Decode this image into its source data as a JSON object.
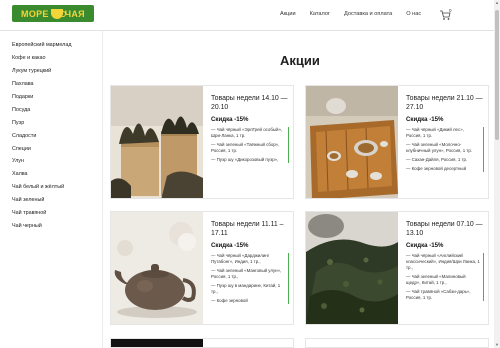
{
  "logo": {
    "left": "МОРЕ",
    "right": "ЧАЯ"
  },
  "nav": [
    "Акции",
    "Каталог",
    "Доставка и оплата",
    "О нас"
  ],
  "cart": {
    "count": "0"
  },
  "sidebar": {
    "items": [
      "Европейский мармелад",
      "Кофе и какао",
      "Лукум турецкий",
      "Пахлава",
      "Подарки",
      "Посуда",
      "Пуэр",
      "Сладости",
      "Специи",
      "Улун",
      "Халва",
      "Чай белый и жёлтый",
      "Чай зеленый",
      "Чай травяной",
      "Чай черный"
    ]
  },
  "page": {
    "title": "Акции"
  },
  "cards": [
    {
      "title": "Товары недели 14.10 — 20.10",
      "discount": "Скидка -15%",
      "items": [
        "— Чай чёрный «ЭрлГрей особый», Шри-Ланка, 1 тр.",
        "— Чай зеленый «Таёжный сбор», Россия, 1 тр.",
        "— Пуэр шу «Дикорозовый пуэр»,"
      ]
    },
    {
      "title": "Товары недели 21.10 — 27.10",
      "discount": "Скидка -15%",
      "items": [
        "— Чай чёрный «Дикий лес», Россия, 1 тр.",
        "— Чай зеленый «Молочно-клубничный улун», Россия, 1 тр.",
        "— Сахан-Дайля, Россия, 1 тр.",
        "— Кофе зерновой десертный"
      ]
    },
    {
      "title": "Товары недели 11.11 – 17.11",
      "discount": "Скидка -15%",
      "items": [
        "— Чай чёрный «Дарджилинг Путабонг», Индия, 1 тр.,",
        "— Чай зеленый «Манговый улун», Россия, 1 тр.,",
        "— Пуэр шу в мандарине, Китай, 1 тр.,",
        "— Кофе зерновой"
      ]
    },
    {
      "title": "Товары недели 07.10 — 13.10",
      "discount": "Скидка -15%",
      "items": [
        "— Чай чёрный «Английский классический», Индия/Шри Ланка, 1 тр.,",
        "— Чай зеленый «Малиновый щедр», Китай, 1 тр.,",
        "— Чай травяной «Сабзи-дарь», Россия, 1 тр."
      ]
    }
  ]
}
